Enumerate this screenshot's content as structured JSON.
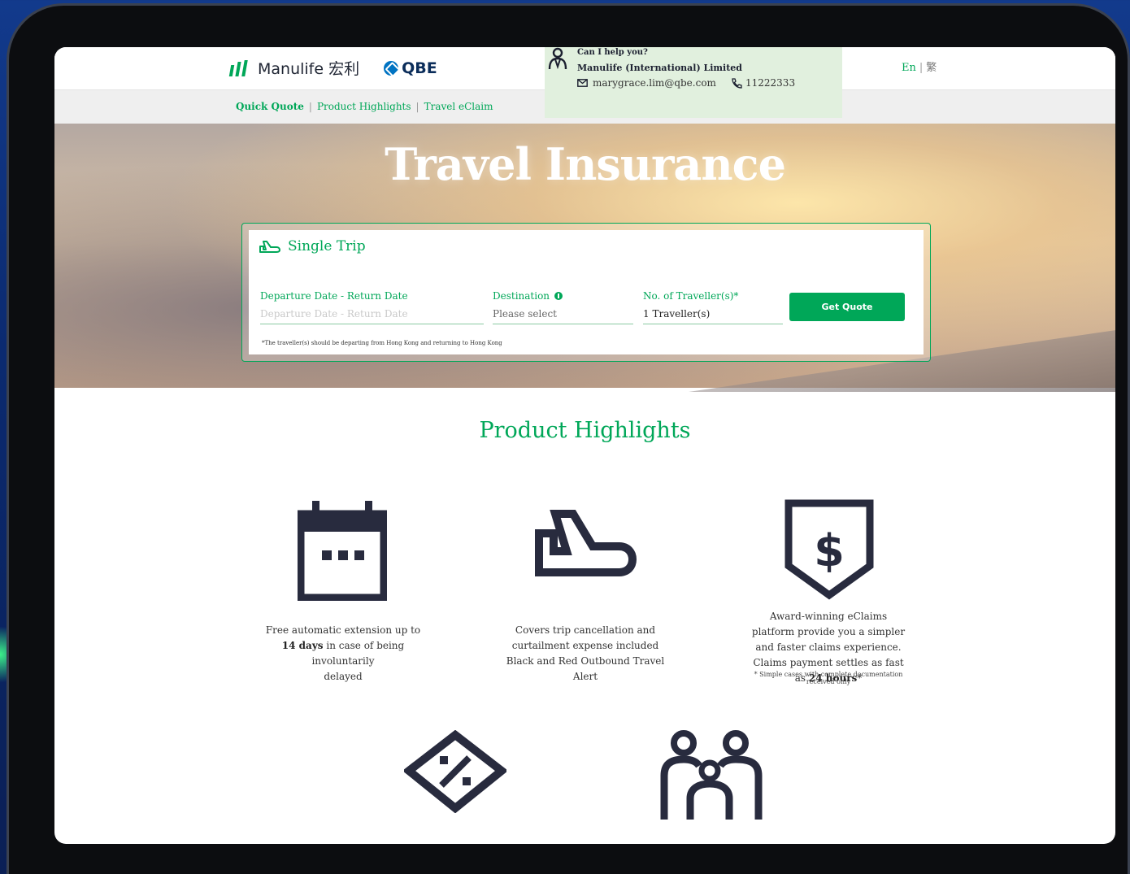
{
  "header": {
    "manulife_logo": "Manulife 宏利",
    "qbe_logo": "QBE",
    "help": {
      "title": "Can I help you?",
      "company": "Manulife (International) Limited",
      "email": "marygrace.lim@qbe.com",
      "phone": "11222333"
    },
    "lang": {
      "en": "En",
      "sep": "|",
      "zh": "繁"
    }
  },
  "nav": {
    "items": [
      {
        "label": "Quick Quote"
      },
      {
        "label": "Product Highlights"
      },
      {
        "label": "Travel eClaim"
      }
    ],
    "sep": "|"
  },
  "hero": {
    "title": "Travel Insurance",
    "card": {
      "trip_type": "Single Trip",
      "date_label": "Departure Date - Return Date",
      "date_placeholder": "Departure Date - Return Date",
      "destination_label": "Destination",
      "destination_value": "Please select",
      "travellers_label": "No. of Traveller(s)*",
      "travellers_value": "1 Traveller(s)",
      "button": "Get Quote",
      "footnote": "*The traveller(s) should be departing from Hong Kong and returning to Hong Kong"
    }
  },
  "highlights": {
    "title": "Product Highlights",
    "items": [
      {
        "icon": "calendar-icon",
        "line1": "Free automatic extension up to",
        "bold": "14 days",
        "line2": " in case of being involuntarily",
        "line3": "delayed"
      },
      {
        "icon": "plane-icon",
        "text": "Covers trip cancellation and curtailment expense included Black and Red Outbound Travel Alert"
      },
      {
        "icon": "dollar-shield-icon",
        "text": "Award-winning eClaims platform provide you a simpler and faster claims experience. Claims payment settles as fast as ",
        "bold": "24 hours",
        "suffix": "*",
        "note": "* Simple cases with complete documentation received only"
      },
      {
        "icon": "discount-tag-icon"
      },
      {
        "icon": "family-icon"
      }
    ]
  },
  "colors": {
    "brand_green": "#00a758",
    "help_bg": "#e1f0de",
    "icon_dark": "#282b3e"
  }
}
